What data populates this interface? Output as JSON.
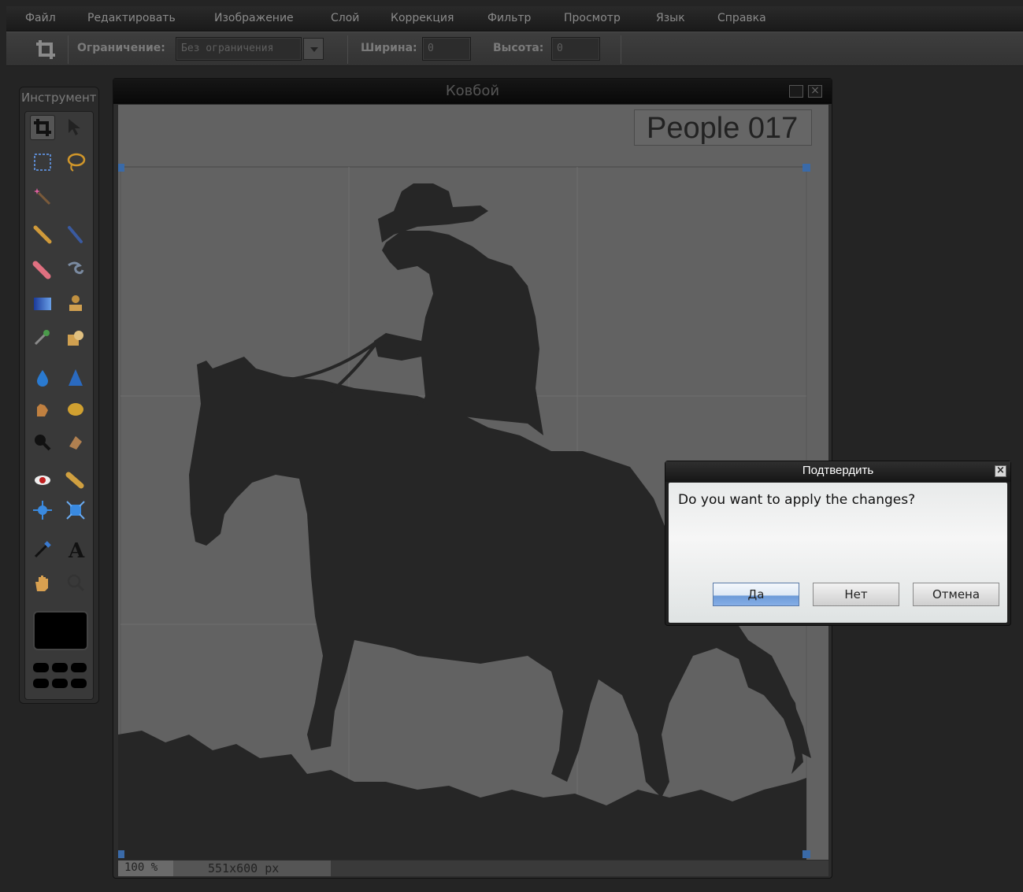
{
  "menu": [
    "Файл",
    "Редактировать",
    "Изображение",
    "Слой",
    "Коррекция",
    "Фильтр",
    "Просмотр",
    "Язык",
    "Справка"
  ],
  "options": {
    "constraint_label": "Ограничение:",
    "constraint_value": "Без ограничения",
    "width_label": "Ширина:",
    "width_value": "0",
    "height_label": "Высота:",
    "height_value": "0"
  },
  "tools": {
    "title": "Инструмент"
  },
  "document": {
    "title": "Ковбой",
    "image_label": "People 017",
    "zoom": "100 %",
    "dimensions": "551x600 px"
  },
  "dialog": {
    "title": "Подтвердить",
    "close": "×",
    "message": "Do you want to apply the changes?",
    "buttons": {
      "yes": "Да",
      "no": "Нет",
      "cancel": "Отмена"
    }
  },
  "colors": {
    "background": "#242424",
    "canvas": "#626262",
    "silhouette": "#262626",
    "foreground_color": "#000000"
  }
}
